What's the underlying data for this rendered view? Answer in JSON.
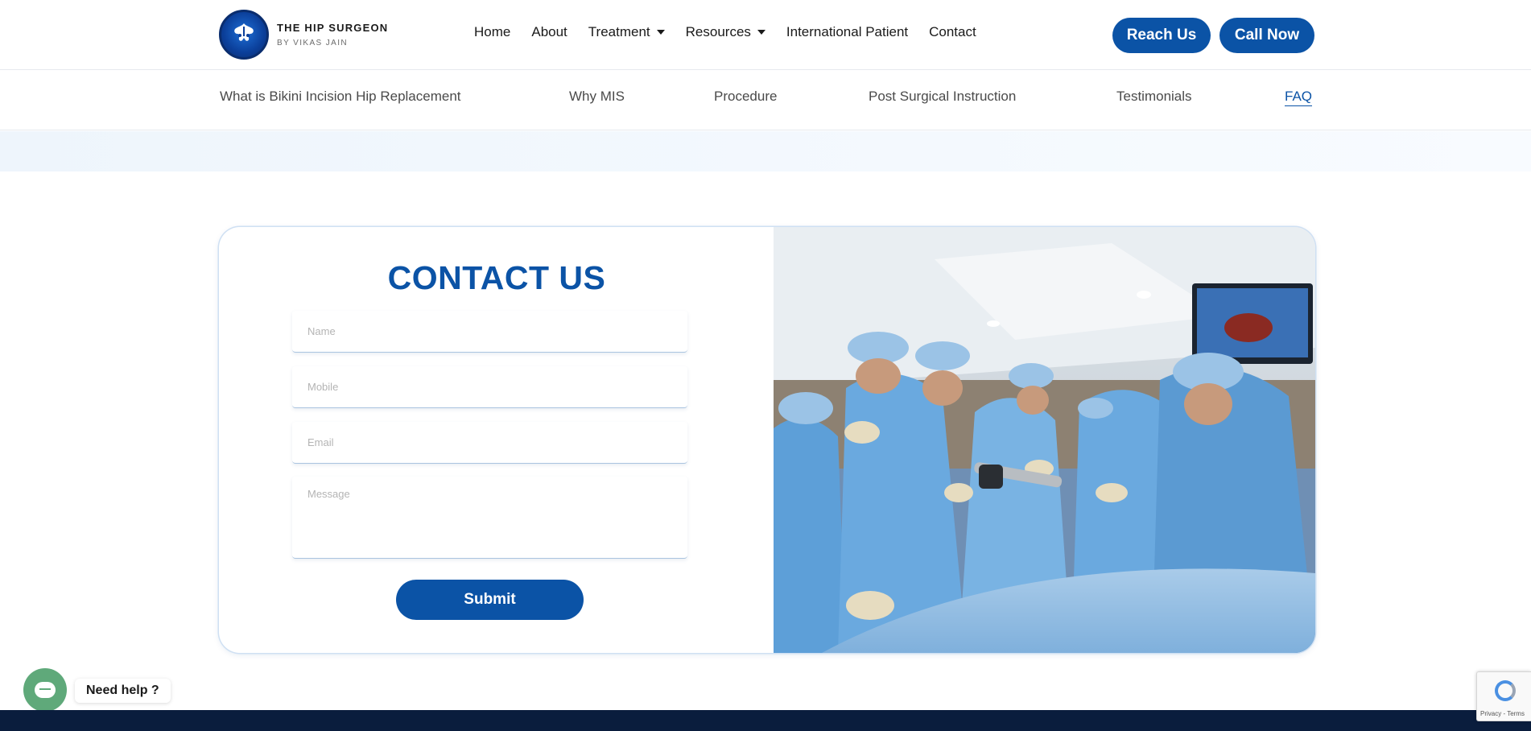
{
  "brand": {
    "title": "THE HIP SURGEON",
    "subtitle": "BY VIKAS JAIN"
  },
  "nav": {
    "items": [
      {
        "label": "Home",
        "has_dropdown": false
      },
      {
        "label": "About",
        "has_dropdown": false
      },
      {
        "label": "Treatment",
        "has_dropdown": true
      },
      {
        "label": "Resources",
        "has_dropdown": true
      },
      {
        "label": "International Patient",
        "has_dropdown": false
      },
      {
        "label": "Contact",
        "has_dropdown": false
      }
    ],
    "reach_label": "Reach Us",
    "call_label": "Call Now"
  },
  "subnav": {
    "items": [
      {
        "label": "What is Bikini Incision Hip Replacement",
        "active": false
      },
      {
        "label": "Why MIS",
        "active": false
      },
      {
        "label": "Procedure",
        "active": false
      },
      {
        "label": "Post Surgical Instruction",
        "active": false
      },
      {
        "label": "Testimonials",
        "active": false
      },
      {
        "label": "FAQ",
        "active": true
      }
    ]
  },
  "contact": {
    "title": "CONTACT US",
    "name_placeholder": "Name",
    "mobile_placeholder": "Mobile",
    "email_placeholder": "Email",
    "message_placeholder": "Message",
    "submit_label": "Submit"
  },
  "help": {
    "label": "Need help ?"
  },
  "recaptcha": {
    "text": "Privacy - Terms"
  },
  "colors": {
    "brand_blue": "#0b53a6",
    "help_green": "#5fa97a",
    "footer_navy": "#0a1d3d"
  }
}
